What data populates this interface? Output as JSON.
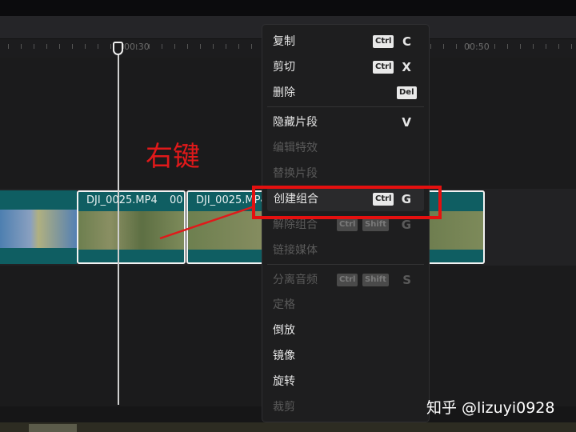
{
  "ruler": {
    "labels": [
      "00:30",
      "00:50"
    ]
  },
  "clips": [
    {
      "label": ""
    },
    {
      "label": "DJI_0025.MP4",
      "label2": "00"
    },
    {
      "label": "DJI_0025.MP4"
    }
  ],
  "menu": {
    "items": [
      {
        "label": "复制",
        "mods": [
          "Ctrl"
        ],
        "key": "C",
        "enabled": true
      },
      {
        "label": "剪切",
        "mods": [
          "Ctrl"
        ],
        "key": "X",
        "enabled": true
      },
      {
        "label": "删除",
        "mods": [
          "Del"
        ],
        "key": "",
        "enabled": true
      },
      {
        "label": "隐藏片段",
        "mods": [],
        "key": "V",
        "enabled": true
      },
      {
        "label": "编辑特效",
        "mods": [],
        "key": "",
        "enabled": false
      },
      {
        "label": "替换片段",
        "mods": [],
        "key": "",
        "enabled": false
      },
      {
        "label": "创建组合",
        "mods": [
          "Ctrl"
        ],
        "key": "G",
        "enabled": true,
        "highlighted": true
      },
      {
        "label": "解除组合",
        "mods": [
          "Ctrl",
          "Shift"
        ],
        "key": "G",
        "enabled": false
      },
      {
        "label": "链接媒体",
        "mods": [],
        "key": "",
        "enabled": false
      },
      {
        "label": "分离音频",
        "mods": [
          "Ctrl",
          "Shift"
        ],
        "key": "S",
        "enabled": false
      },
      {
        "label": "定格",
        "mods": [],
        "key": "",
        "enabled": false
      },
      {
        "label": "倒放",
        "mods": [],
        "key": "",
        "enabled": true
      },
      {
        "label": "镜像",
        "mods": [],
        "key": "",
        "enabled": true
      },
      {
        "label": "旋转",
        "mods": [],
        "key": "",
        "enabled": true
      },
      {
        "label": "裁剪",
        "mods": [],
        "key": "",
        "enabled": false
      }
    ]
  },
  "annotation": {
    "text": "右键",
    "color": "#e0191a"
  },
  "watermark": "知乎 @lizuyi0928"
}
